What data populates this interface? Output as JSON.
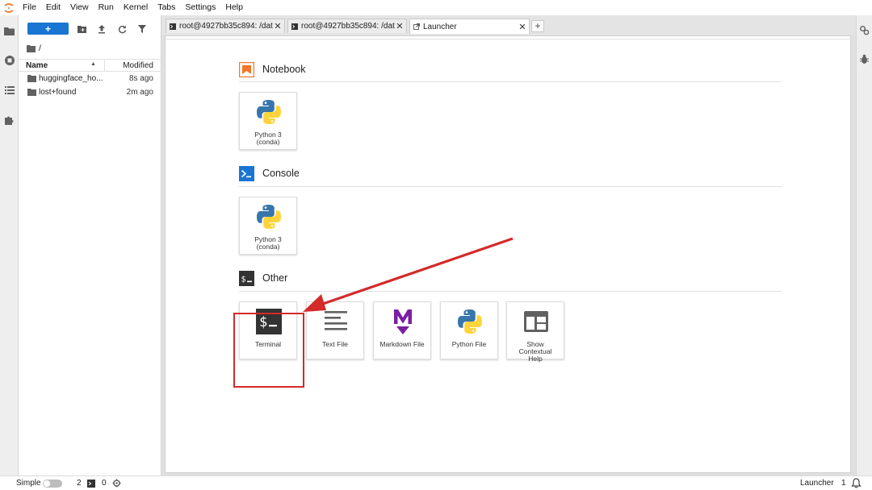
{
  "menubar": {
    "items": [
      "File",
      "Edit",
      "View",
      "Run",
      "Kernel",
      "Tabs",
      "Settings",
      "Help"
    ]
  },
  "filebrowser": {
    "new_button_label": "+",
    "breadcrumb": "/",
    "columns": {
      "name": "Name",
      "modified": "Modified"
    },
    "files": [
      {
        "name": "huggingface_ho...",
        "modified": "8s ago",
        "icon": "folder-icon"
      },
      {
        "name": "lost+found",
        "modified": "2m ago",
        "icon": "folder-icon"
      }
    ]
  },
  "tabs": [
    {
      "label": "root@4927bb35c894: /dat",
      "icon": "terminal-icon",
      "close": "✕"
    },
    {
      "label": "root@4927bb35c894: /dat",
      "icon": "terminal-icon",
      "close": "✕"
    },
    {
      "label": "Launcher",
      "icon": "launcher-icon",
      "close": "✕",
      "active": true
    }
  ],
  "add_tab_label": "+",
  "launcher": {
    "sections": [
      {
        "title": "Notebook",
        "icon": "notebook-icon",
        "cards": [
          {
            "label": "Python 3\n(conda)",
            "icon": "python-icon"
          }
        ]
      },
      {
        "title": "Console",
        "icon": "console-icon",
        "cards": [
          {
            "label": "Python 3\n(conda)",
            "icon": "python-icon"
          }
        ]
      },
      {
        "title": "Other",
        "icon": "other-icon",
        "cards": [
          {
            "label": "Terminal",
            "icon": "terminal-icon"
          },
          {
            "label": "Text File",
            "icon": "text-file-icon"
          },
          {
            "label": "Markdown File",
            "icon": "markdown-icon"
          },
          {
            "label": "Python File",
            "icon": "python-icon"
          },
          {
            "label": "Show\nContextual\nHelp",
            "icon": "contextual-help-icon"
          }
        ]
      }
    ]
  },
  "statusbar": {
    "mode_label": "Simple",
    "terminals_count": "2",
    "kernels_count": "0",
    "right_label": "Launcher",
    "right_count": "1"
  },
  "colors": {
    "accent": "#1976d2",
    "notebook_orange": "#f37726",
    "console_blue": "#1976d2",
    "annotation_red": "#d42a2a",
    "markdown_purple": "#7b1fa2"
  }
}
